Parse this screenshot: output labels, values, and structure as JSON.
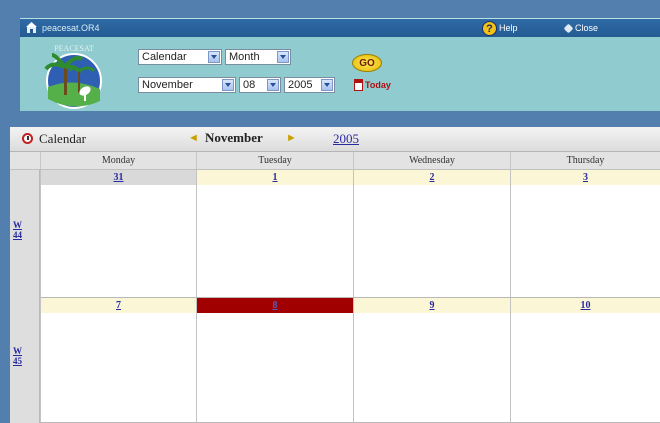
{
  "app": {
    "name": "peacesat.OR4",
    "help_label": "Help",
    "close_label": "Close"
  },
  "logo": {
    "text": "PEACESAT"
  },
  "controls": {
    "view_select": "Calendar",
    "range_select": "Month",
    "month_select": "November",
    "day_select": "08",
    "year_select": "2005",
    "go_label": "GO",
    "today_label": "Today"
  },
  "calendar": {
    "title": "Calendar",
    "month": "November",
    "year": "2005",
    "days_of_week": [
      "Monday",
      "Tuesday",
      "Wednesday",
      "Thursday"
    ],
    "weeks": [
      {
        "label_w": "W",
        "label_n": "44",
        "days": [
          "31",
          "1",
          "2",
          "3"
        ]
      },
      {
        "label_w": "W",
        "label_n": "45",
        "days": [
          "7",
          "8",
          "9",
          "10"
        ]
      }
    ],
    "today_index": {
      "week": 1,
      "day": 1
    }
  },
  "colors": {
    "title_bar": "#245b93",
    "header_panel": "#8fcbcf",
    "today_highlight": "#a10000",
    "day_header": "#fbf7d6",
    "link": "#2a2aa0"
  }
}
